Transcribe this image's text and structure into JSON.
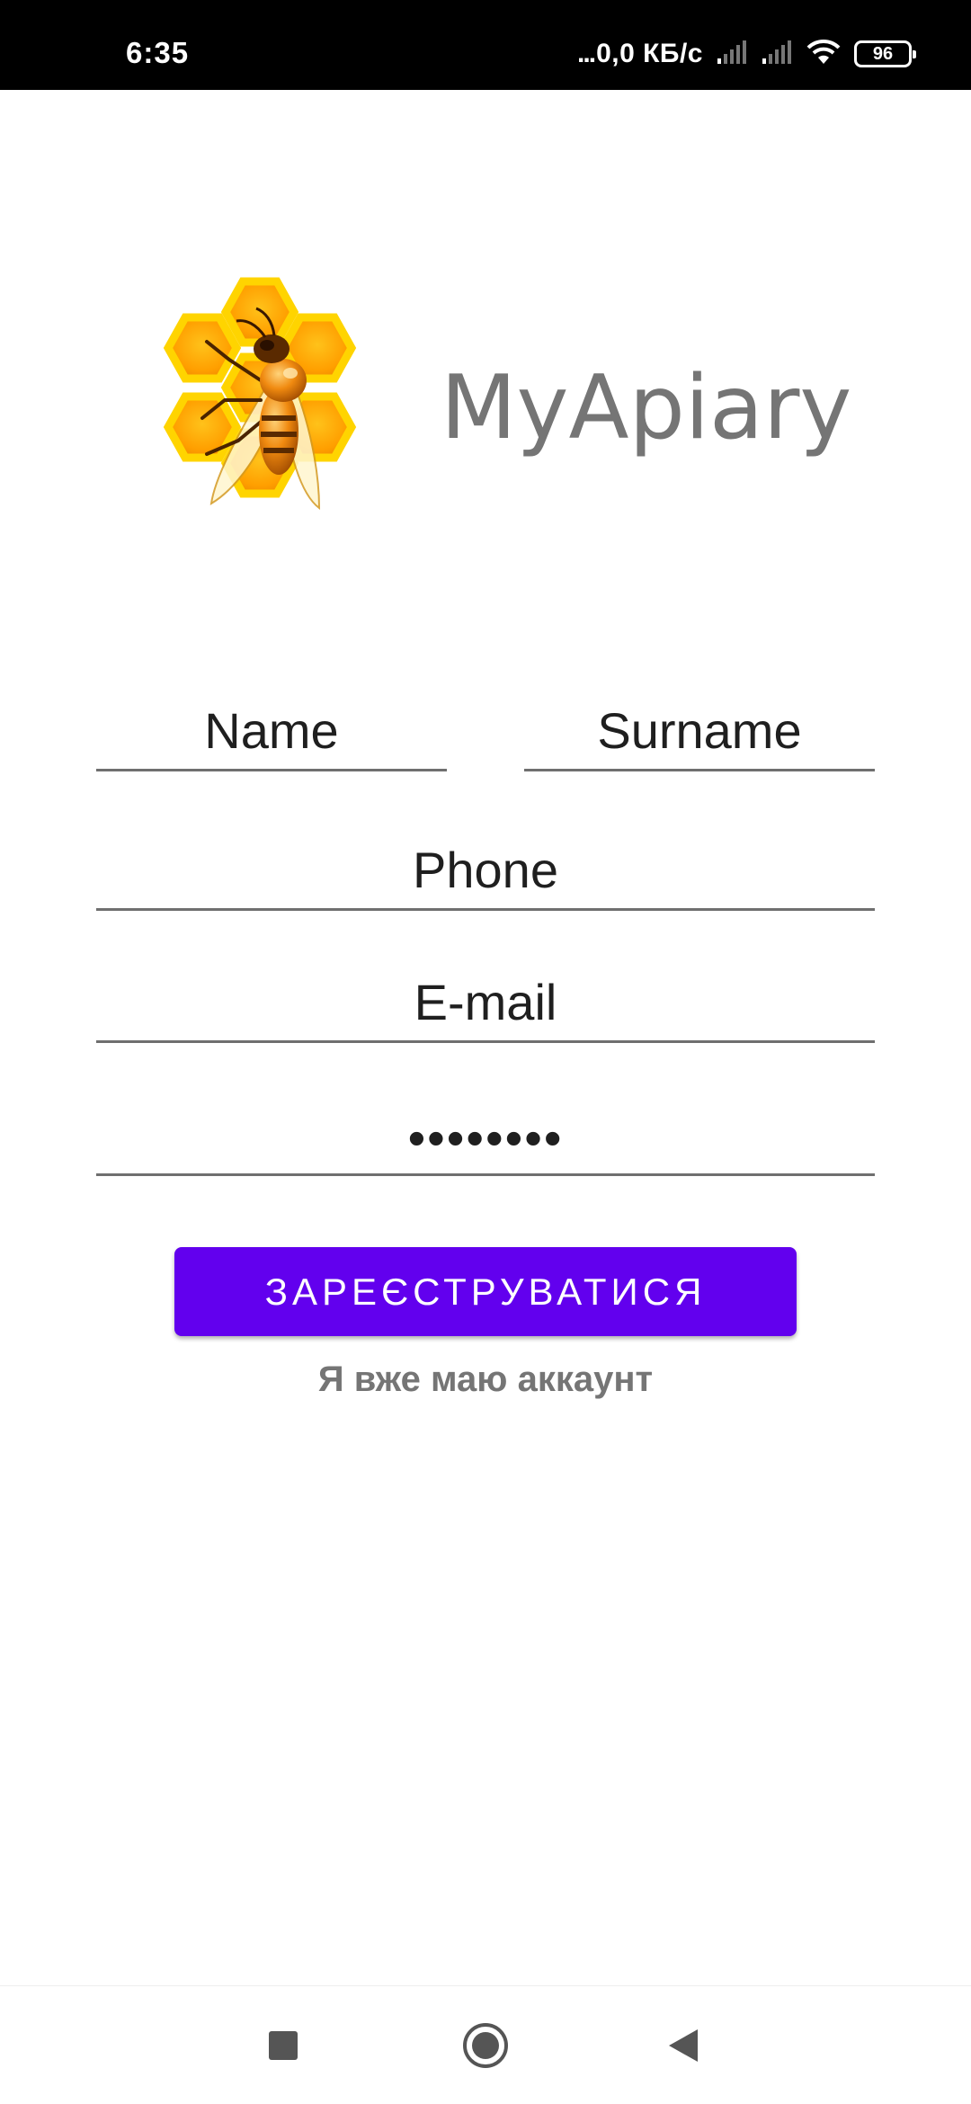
{
  "status_bar": {
    "time": "6:35",
    "network_dots": "...",
    "network_speed": "0,0 КБ/с",
    "battery_level": "96",
    "icons": [
      "signal-icon",
      "signal-icon",
      "wifi-icon",
      "battery-icon"
    ]
  },
  "app": {
    "title": "MyApiary",
    "logo_icon": "bee-honeycomb-logo"
  },
  "form": {
    "name_placeholder": "Name",
    "surname_placeholder": "Surname",
    "phone_placeholder": "Phone",
    "email_placeholder": "E-mail",
    "password_value": "••••••••"
  },
  "actions": {
    "register_label": "ЗАРЕЄСТРУВАТИСЯ",
    "login_link": "Я вже маю аккаунт"
  },
  "nav_bar": {
    "icons": [
      "recents-icon",
      "home-icon",
      "back-icon"
    ]
  },
  "colors": {
    "accent": "#6200ee",
    "title_gray": "#757575",
    "honey": "#ffb300"
  }
}
